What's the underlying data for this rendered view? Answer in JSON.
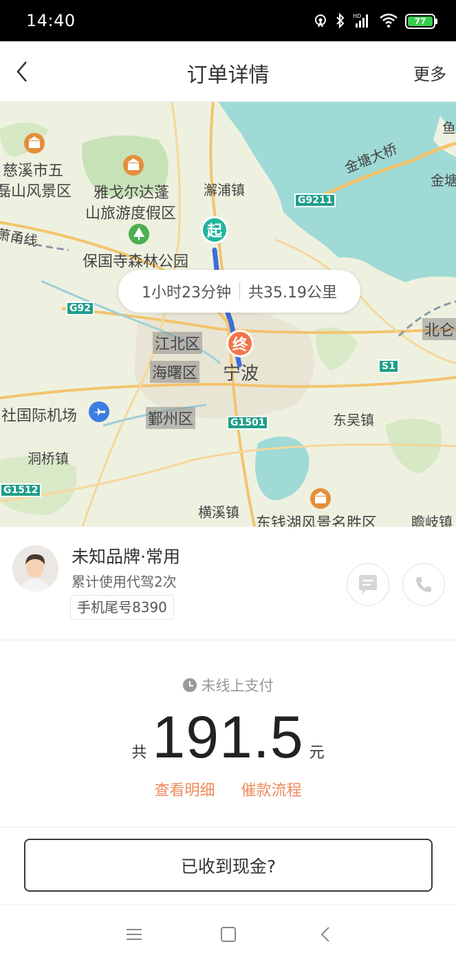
{
  "status_bar": {
    "time": "14:40",
    "battery_level": "77",
    "icons": [
      "hotspot-icon",
      "bluetooth-icon",
      "signal-icon",
      "wifi-icon",
      "battery-icon"
    ]
  },
  "header": {
    "title": "订单详情",
    "more_label": "更多"
  },
  "map": {
    "route_duration": "1小时23分钟",
    "route_distance": "共35.19公里",
    "start_marker": "起",
    "end_marker": "终",
    "labels": {
      "cixi": "慈溪市五",
      "cixi2": "磊山风景区",
      "yage": "雅戈尔达蓬",
      "yage2": "山旅游度假区",
      "xiepu": "澥浦镇",
      "jintang_bridge": "金塘大桥",
      "jintang": "金塘",
      "yu": "鱼",
      "xiaoyong": "萧甬线",
      "baoguosi": "保国寺森林公园",
      "jiangbei": "江北区",
      "haishu": "海曙区",
      "ningbo": "宁波",
      "beilun": "北仑",
      "airport": "社国际机场",
      "yinzhou": "鄞州区",
      "dongwu": "东吴镇",
      "dongqiao": "洞桥镇",
      "hengxi": "横溪镇",
      "dongqianhu": "东钱湖风景名胜区",
      "zhanqi": "瞻岐镇"
    },
    "shields": {
      "g9211": "G9211",
      "g92": "G92",
      "s1": "S1",
      "g1501": "G1501",
      "g1512": "G1512"
    }
  },
  "driver": {
    "name": "未知品牌·常用",
    "usage": "累计使用代驾2次",
    "phone_tail": "手机尾号8390"
  },
  "payment": {
    "status": "未线上支付",
    "prefix": "共",
    "amount": "191.5",
    "unit": "元",
    "detail_link": "查看明细",
    "collect_link": "催款流程"
  },
  "actions": {
    "cash_received": "已收到现金?"
  },
  "colors": {
    "accent_orange": "#ef8a5c",
    "start_green": "#22b59c",
    "end_orange": "#f2774c",
    "sea": "#9fdad6"
  }
}
